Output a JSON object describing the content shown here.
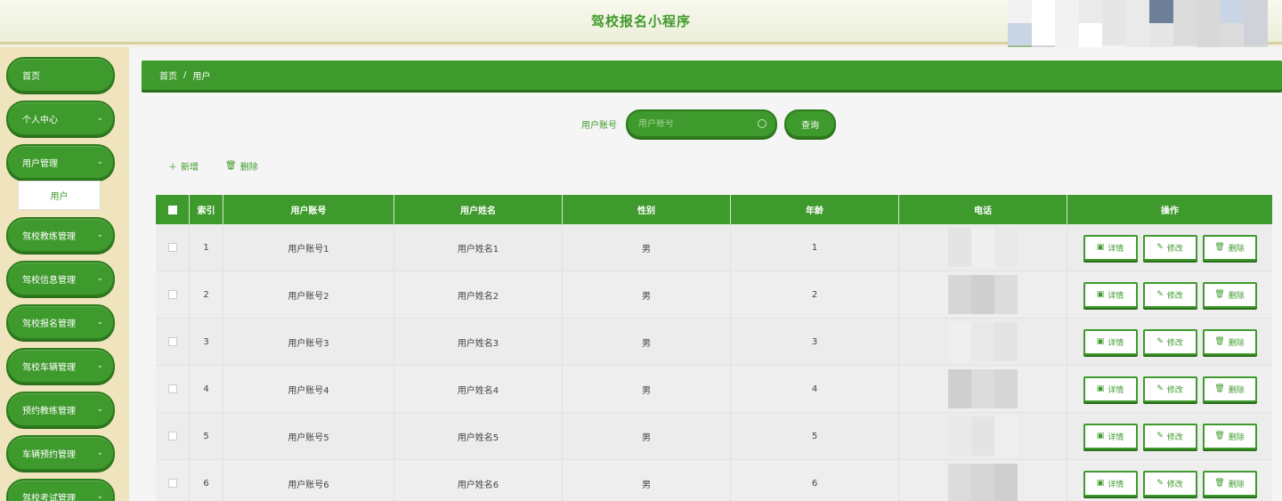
{
  "header": {
    "title": "驾校报名小程序"
  },
  "sidebar": {
    "items": [
      {
        "label": "首页",
        "has_chevron": false
      },
      {
        "label": "个人中心",
        "has_chevron": true
      },
      {
        "label": "用户管理",
        "has_chevron": true
      },
      {
        "label": "驾校教练管理",
        "has_chevron": true
      },
      {
        "label": "驾校信息管理",
        "has_chevron": true
      },
      {
        "label": "驾校报名管理",
        "has_chevron": true
      },
      {
        "label": "驾校车辆管理",
        "has_chevron": true
      },
      {
        "label": "预约教练管理",
        "has_chevron": true
      },
      {
        "label": "车辆预约管理",
        "has_chevron": true
      },
      {
        "label": "驾校考试管理",
        "has_chevron": true
      }
    ],
    "submenu": {
      "label": "用户"
    }
  },
  "breadcrumb": {
    "home": "首页",
    "separator": "/",
    "current": "用户"
  },
  "search": {
    "label": "用户账号",
    "placeholder": "用户账号",
    "button": "查询"
  },
  "toolbar": {
    "add": "新增",
    "delete": "删除"
  },
  "table": {
    "headers": [
      "索引",
      "用户账号",
      "用户姓名",
      "性别",
      "年龄",
      "电话",
      "操作"
    ],
    "rows": [
      {
        "index": "1",
        "account": "用户账号1",
        "name": "用户姓名1",
        "gender": "男",
        "age": "1"
      },
      {
        "index": "2",
        "account": "用户账号2",
        "name": "用户姓名2",
        "gender": "男",
        "age": "2"
      },
      {
        "index": "3",
        "account": "用户账号3",
        "name": "用户姓名3",
        "gender": "男",
        "age": "3"
      },
      {
        "index": "4",
        "account": "用户账号4",
        "name": "用户姓名4",
        "gender": "男",
        "age": "4"
      },
      {
        "index": "5",
        "account": "用户账号5",
        "name": "用户姓名5",
        "gender": "男",
        "age": "5"
      },
      {
        "index": "6",
        "account": "用户账号6",
        "name": "用户姓名6",
        "gender": "男",
        "age": "6"
      }
    ],
    "actions": {
      "detail": "详情",
      "edit": "修改",
      "delete": "删除"
    }
  },
  "colors": {
    "primary": "#3e9a2c",
    "sidebar_bg": "#efe4bd",
    "header_title": "#3f9a2a"
  }
}
